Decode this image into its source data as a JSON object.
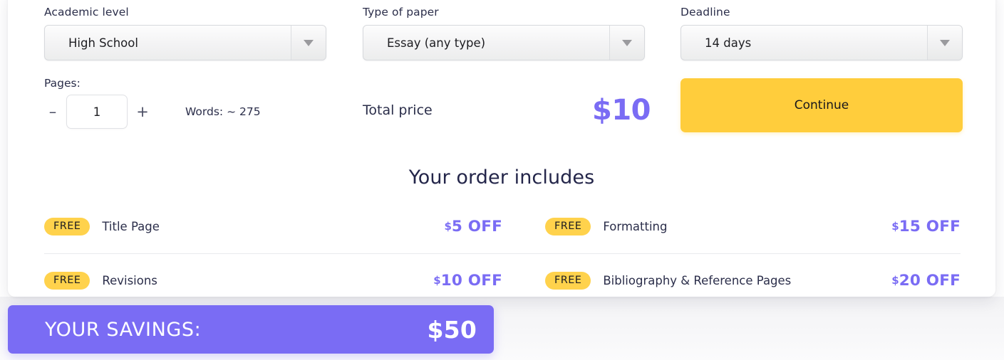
{
  "form": {
    "fields": [
      {
        "label": "Academic level",
        "value": "High School",
        "icon": "chevron-down-icon"
      },
      {
        "label": "Type of paper",
        "value": "Essay (any type)",
        "icon": "chevron-down-icon"
      },
      {
        "label": "Deadline",
        "value": "14 days",
        "icon": "chevron-down-icon"
      }
    ],
    "pages": {
      "label": "Pages:",
      "value": "1",
      "decrement": "–",
      "increment": "+",
      "words": "Words: ~ 275"
    },
    "total": {
      "label": "Total price",
      "amount": "$10"
    },
    "continue_label": "Continue"
  },
  "includes": {
    "title": "Your order includes",
    "badge_label": "FREE",
    "currency": "$",
    "rows": [
      [
        {
          "badge": "FREE",
          "name": "Title Page",
          "off_currency": "$",
          "off_amount": "5 OFF"
        },
        {
          "badge": "FREE",
          "name": "Formatting",
          "off_currency": "$",
          "off_amount": "15 OFF"
        }
      ],
      [
        {
          "badge": "FREE",
          "name": "Revisions",
          "off_currency": "$",
          "off_amount": "10 OFF"
        },
        {
          "badge": "FREE",
          "name": "Bibliography & Reference Pages",
          "off_currency": "$",
          "off_amount": "20 OFF"
        }
      ]
    ]
  },
  "savings": {
    "label": "YOUR SAVINGS:",
    "amount": "$50"
  },
  "colors": {
    "accent_purple": "#7a6cf4",
    "accent_yellow": "#ffcd3c",
    "badge_yellow": "#ffd24c",
    "text_dark": "#2b2e4a"
  }
}
